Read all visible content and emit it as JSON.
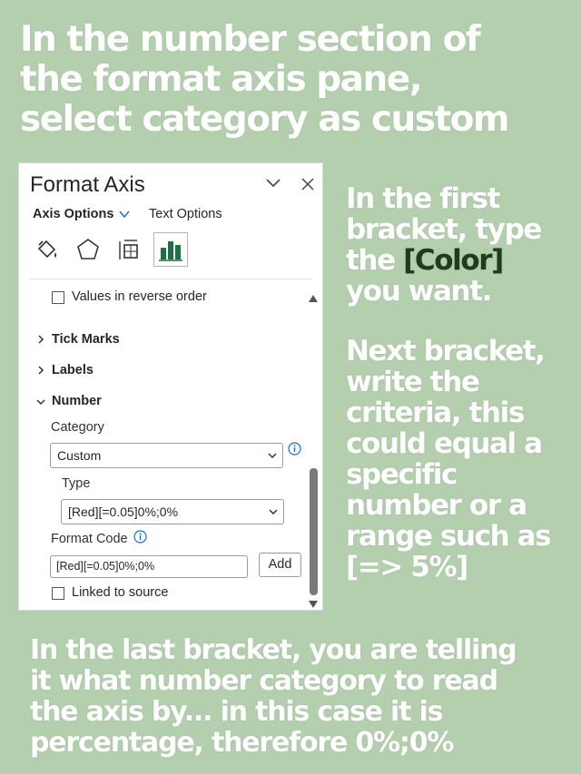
{
  "headline": {
    "line1": "In the number section of",
    "line2": "the format axis pane,",
    "line3": "select category as custom"
  },
  "side_note_1": {
    "line1": "In the first",
    "line2": "bracket, type",
    "line3_pre": "the ",
    "line3_highlight": "[Color]",
    "line4": "you want."
  },
  "side_note_2": {
    "lines": [
      "Next bracket,",
      "write the",
      "criteria, this",
      "could equal a",
      "specific",
      "number or a",
      "range such as",
      "[=> 5%]"
    ]
  },
  "footer": {
    "lines": [
      "In the last bracket, you are telling",
      "it what number category to read",
      "the axis by... in this case it is",
      "percentage, therefore 0%;0%"
    ]
  },
  "pane": {
    "title": "Format Axis",
    "tab_axis_options": "Axis Options",
    "tab_text_options": "Text Options",
    "reverse_order_label": "Values in reverse order",
    "sections": {
      "tick_marks": "Tick Marks",
      "labels": "Labels",
      "number": "Number"
    },
    "category_label": "Category",
    "category_value": "Custom",
    "type_label": "Type",
    "type_value": "[Red][=0.05]0%;0%",
    "format_code_label": "Format Code",
    "format_code_value": "[Red][=0.05]0%;0%",
    "add_button": "Add",
    "linked_label": "Linked to source",
    "accent_color": "#1e7145"
  },
  "colors": {
    "background": "#b3cfae",
    "headline_text": "#ffffff",
    "highlight_text": "#1f3a1c"
  }
}
